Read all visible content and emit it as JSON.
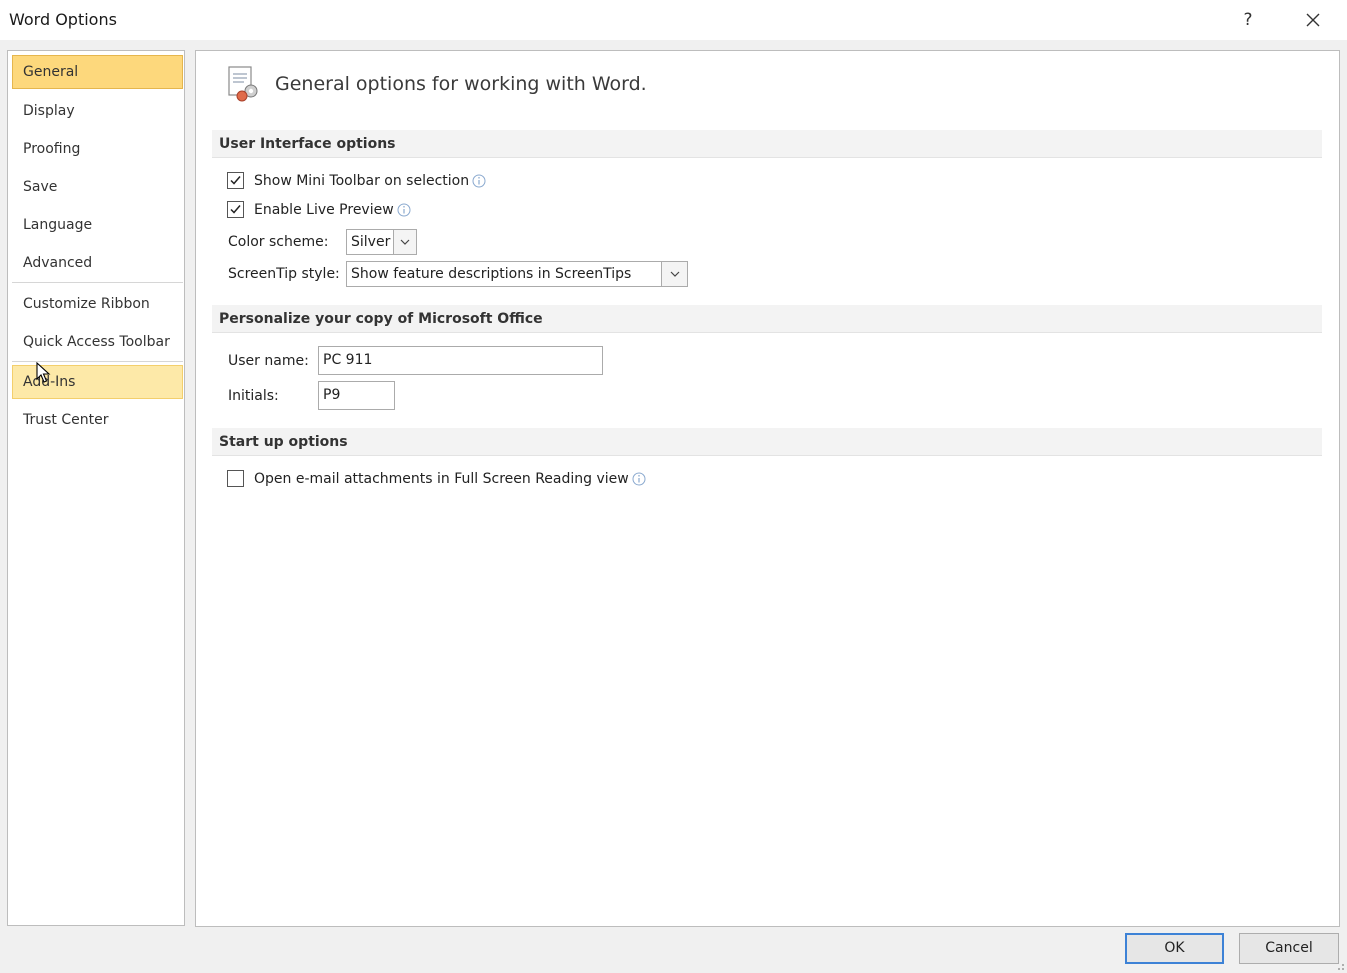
{
  "window": {
    "title": "Word Options",
    "help_label": "?"
  },
  "nav": {
    "items": [
      {
        "label": "General"
      },
      {
        "label": "Display"
      },
      {
        "label": "Proofing"
      },
      {
        "label": "Save"
      },
      {
        "label": "Language"
      },
      {
        "label": "Advanced"
      },
      {
        "label": "Customize Ribbon"
      },
      {
        "label": "Quick Access Toolbar"
      },
      {
        "label": "Add-Ins"
      },
      {
        "label": "Trust Center"
      }
    ],
    "selected": "General",
    "hovered": "Add-Ins"
  },
  "content": {
    "header": "General options for working with Word.",
    "sections": {
      "ui": {
        "title": "User Interface options",
        "mini_toolbar": {
          "label": "Show Mini Toolbar on selection",
          "checked": true
        },
        "live_preview": {
          "label": "Enable Live Preview",
          "checked": true
        },
        "color_scheme": {
          "label": "Color scheme:",
          "value": "Silver"
        },
        "screentip": {
          "label": "ScreenTip style:",
          "value": "Show feature descriptions in ScreenTips"
        }
      },
      "personalize": {
        "title": "Personalize your copy of Microsoft Office",
        "user_name": {
          "label": "User name:",
          "value": "PC 911"
        },
        "initials": {
          "label": "Initials:",
          "value": "P9"
        }
      },
      "startup": {
        "title": "Start up options",
        "open_email": {
          "label": "Open e-mail attachments in Full Screen Reading view",
          "checked": false
        }
      }
    }
  },
  "footer": {
    "ok": "OK",
    "cancel": "Cancel"
  },
  "colors": {
    "nav_selected": "#fdd87c",
    "nav_hover": "#fde9a8",
    "ok_border": "#3d82d6"
  }
}
